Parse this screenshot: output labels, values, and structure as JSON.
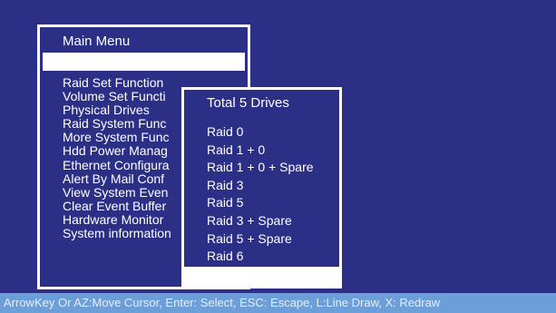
{
  "main_menu": {
    "title": "Main Menu",
    "items": [
      "Raid Set Function",
      "Volume Set Functi",
      "Physical Drives",
      "Raid System Func",
      "More System Func",
      "Hdd Power Manag",
      "Ethernet Configura",
      "Alert By Mail Conf",
      "View System Even",
      "Clear Event Buffer",
      "Hardware Monitor",
      "System information"
    ]
  },
  "raid_menu": {
    "title": "Total 5 Drives",
    "options": [
      "Raid 0",
      "Raid 1 + 0",
      "Raid 1 + 0 + Spare",
      "Raid 3",
      "Raid 5",
      "Raid 3 + Spare",
      "Raid 5 + Spare",
      "Raid 6"
    ]
  },
  "status_bar": {
    "text": "ArrowKey Or AZ:Move Cursor, Enter: Select, ESC: Escape, L:Line Draw, X: Redraw"
  },
  "colors": {
    "background": "#2b2f86",
    "border": "#ffffff",
    "highlight": "#ffffff",
    "status_bar": "#6c9fd8"
  }
}
